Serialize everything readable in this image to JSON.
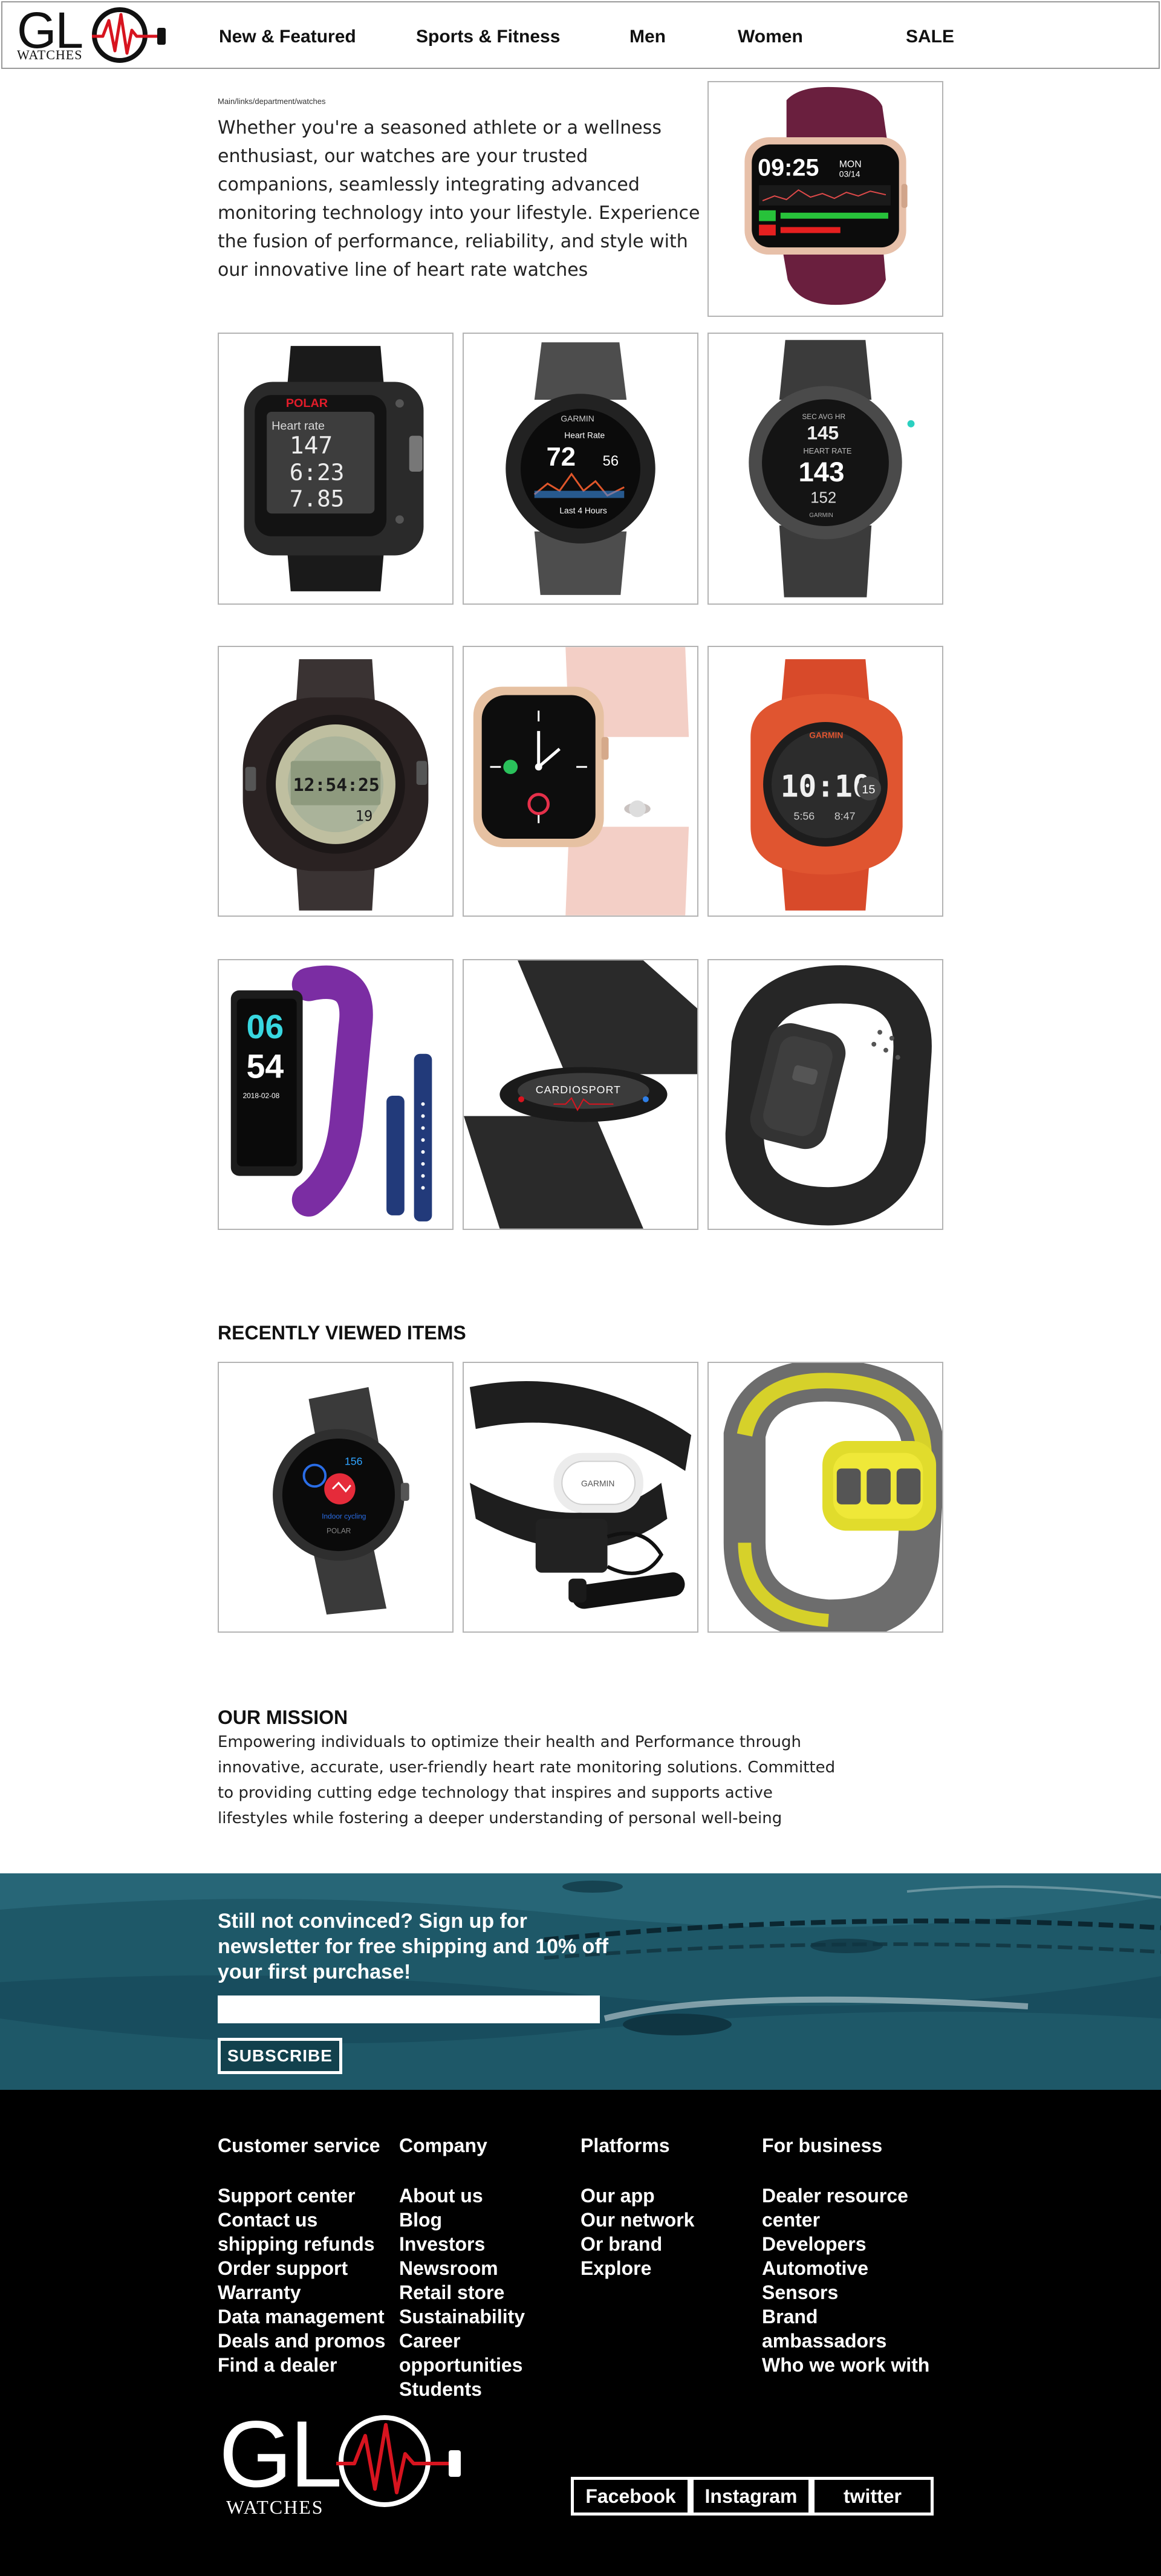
{
  "brand": {
    "name": "GL",
    "sub": "WATCHES"
  },
  "nav": {
    "items": [
      {
        "label": "New & Featured"
      },
      {
        "label": "Sports & Fitness"
      },
      {
        "label": "Men"
      },
      {
        "label": "Women"
      },
      {
        "label": "SALE"
      }
    ]
  },
  "breadcrumb": "Main/links/department/watches",
  "intro": "Whether you're a seasoned athlete or a wellness enthusiast,  our watches are your trusted companions, seamlessly integrating advanced monitoring technology into your lifestyle. Experience the fusion of performance, reliability,  and style with our innovative line of heart rate watches",
  "products": [
    {
      "icon": "polar-heart-rate-watch",
      "brand": "POLAR",
      "lines": [
        "Heart rate",
        "147",
        "6:23",
        "7.85"
      ]
    },
    {
      "icon": "garmin-round-watch",
      "brand": "GARMIN",
      "lines": [
        "Heart Rate",
        "72",
        "56",
        "Last 4 Hours"
      ]
    },
    {
      "icon": "garmin-swim-watch",
      "brand": "GARMIN",
      "lines": [
        "SEC AVG HR",
        "145",
        "HEART RATE",
        "143",
        "152"
      ]
    },
    {
      "icon": "digital-sports-watch",
      "brand": "",
      "lines": [
        "12:54:25",
        "19"
      ]
    },
    {
      "icon": "apple-watch-pink",
      "brand": "",
      "lines": []
    },
    {
      "icon": "garmin-instinct-red",
      "brand": "GARMIN",
      "lines": [
        "10:10",
        "15",
        "5:56",
        "8:47"
      ]
    },
    {
      "icon": "purple-fitness-band",
      "brand": "",
      "lines": [
        "06",
        "54",
        "2018-02-08"
      ]
    },
    {
      "icon": "chest-strap-monitor",
      "brand": "CARDIOSPORT",
      "lines": []
    },
    {
      "icon": "armband-monitor",
      "brand": "",
      "lines": []
    }
  ],
  "recent": {
    "title": "RECENTLY VIEWED ITEMS",
    "items": [
      {
        "icon": "polar-round-watch",
        "brand": "POLAR"
      },
      {
        "icon": "garmin-chest-strap",
        "brand": "GARMIN"
      },
      {
        "icon": "yellow-armband"
      }
    ]
  },
  "mission": {
    "title": "OUR MISSION",
    "text": "Empowering individuals to optimize their health and Performance through innovative, accurate, user-friendly heart rate monitoring solutions. Committed to providing cutting edge technology that inspires and supports active lifestyles while fostering a deeper understanding of personal well-being"
  },
  "newsletter": {
    "text": "Still not convinced? Sign up for newsletter for free shipping and 10% off your first purchase!",
    "placeholder": "",
    "button": "SUBSCRIBE"
  },
  "footer": {
    "columns": [
      {
        "title": "Customer service",
        "links": [
          "Support center",
          "Contact us",
          "shipping refunds",
          "Order support",
          "Warranty",
          "Data management",
          "Deals and promos",
          "Find a dealer"
        ]
      },
      {
        "title": "Company",
        "links": [
          "About us",
          "Blog",
          "Investors",
          "Newsroom",
          "Retail store",
          "Sustainability",
          "Career opportunities",
          "Students"
        ]
      },
      {
        "title": "Platforms",
        "links": [
          "Our app",
          "Our network",
          "Or brand",
          "Explore"
        ]
      },
      {
        "title": "For business",
        "links": [
          "Dealer resource center",
          "Developers",
          "Automotive",
          "Sensors",
          "Brand ambassadors",
          "Who we work with"
        ]
      }
    ],
    "social": [
      {
        "label": "Facebook"
      },
      {
        "label": "Instagram"
      },
      {
        "label": "twitter"
      }
    ]
  },
  "colors": {
    "accent": "#d7141f",
    "newsletter_bg": "#1f5a6a",
    "footer_bg": "#000000"
  }
}
